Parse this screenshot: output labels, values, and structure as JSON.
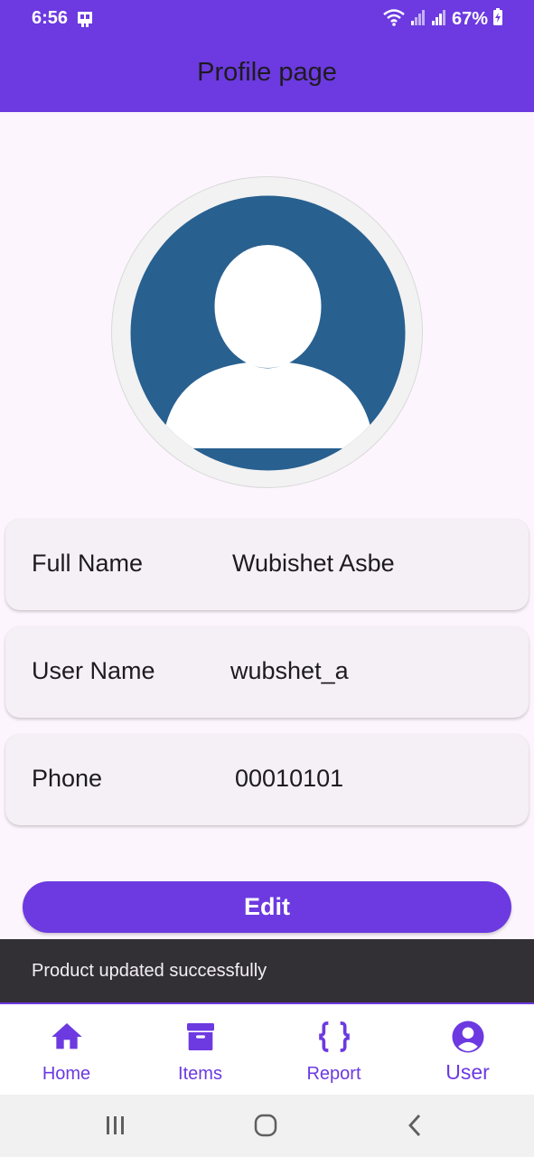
{
  "status_bar": {
    "time": "6:56",
    "battery": "67%",
    "left_icon": "notification-icon",
    "right_icons": [
      "wifi-icon",
      "signal-icon",
      "signal-icon",
      "battery-charging-icon"
    ]
  },
  "app_bar": {
    "title": "Profile page"
  },
  "profile": {
    "avatar_icon": "default-avatar-icon",
    "fields": [
      {
        "label": "Full Name",
        "value": "Wubishet Asbe"
      },
      {
        "label": "User Name",
        "value": "wubshet_a"
      },
      {
        "label": "Phone",
        "value": "00010101"
      }
    ]
  },
  "edit_button": {
    "label": "Edit"
  },
  "snackbar": {
    "message": "Product updated successfully"
  },
  "bottom_nav": {
    "items": [
      {
        "label": "Home",
        "icon": "home-icon",
        "active": false
      },
      {
        "label": "Items",
        "icon": "archive-icon",
        "active": false
      },
      {
        "label": "Report",
        "icon": "code-braces-icon",
        "active": false
      },
      {
        "label": "User",
        "icon": "account-circle-icon",
        "active": true
      }
    ]
  },
  "system_nav": {
    "buttons": [
      "recents-icon",
      "home-circle-icon",
      "back-icon"
    ]
  },
  "colors": {
    "primary": "#6c3ae0",
    "background": "#fdf5fd",
    "card": "#f5f0f6",
    "snackbar": "#322f35",
    "avatar_blue": "#286090"
  }
}
